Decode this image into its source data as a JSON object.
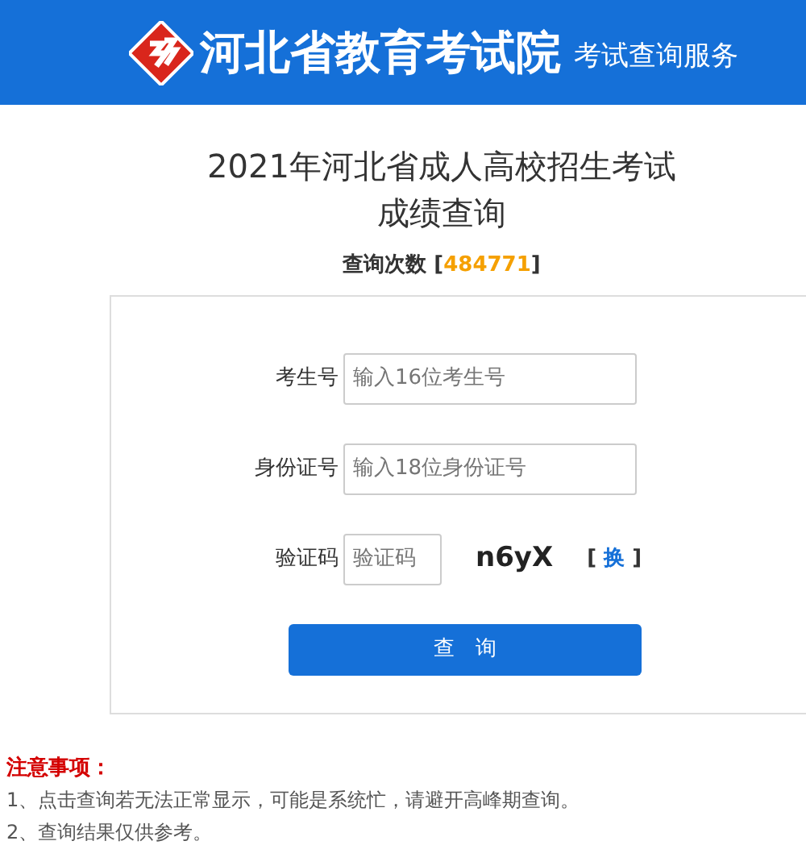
{
  "header": {
    "title": "河北省教育考试院",
    "subtitle": "考试查询服务"
  },
  "heading": [
    "2021年河北省成人高校招生考试",
    "成绩查询"
  ],
  "counter": {
    "label": "查询次数",
    "open": "[",
    "value": "484771",
    "close": "]"
  },
  "fields": [
    {
      "kind": "text",
      "label": "考生号",
      "placeholder": "输入16位考生号"
    },
    {
      "kind": "text",
      "label": "身份证号",
      "placeholder": "输入18位身份证号"
    },
    {
      "kind": "captcha",
      "label": "验证码",
      "placeholder": "验证码",
      "captcha_text": "n6yX",
      "refresh": {
        "open": "[",
        "link": "换",
        "close": "]"
      }
    }
  ],
  "submit": "查　询",
  "notes": {
    "title": "注意事项：",
    "items": [
      "1、点击查询若无法正常显示，可能是系统忙，请避开高峰期查询。",
      "2、查询结果仅供参考。"
    ]
  }
}
